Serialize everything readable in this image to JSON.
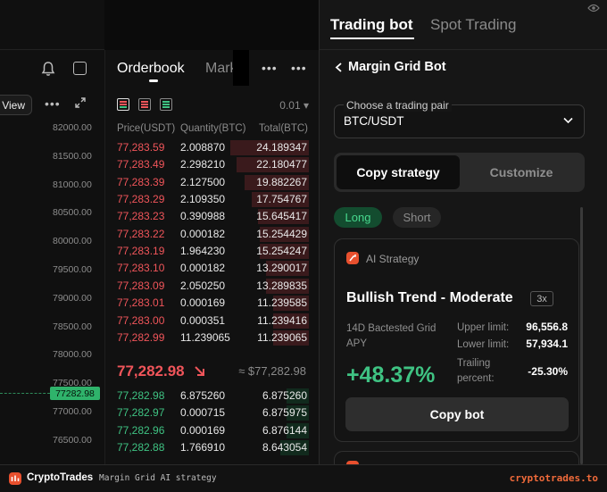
{
  "chart": {
    "view_label": "View",
    "more_icon": "more-horizontal-icon",
    "yaxis": [
      "82000.00",
      "81500.00",
      "81000.00",
      "80500.00",
      "80000.00",
      "79500.00",
      "79000.00",
      "78500.00",
      "78000.00",
      "77500.00",
      "77000.00",
      "76500.00"
    ],
    "current_price_tag": "77282.98"
  },
  "orderbook": {
    "tab_active": "Orderbook",
    "tab_other": "Mark",
    "precision": "0.01 ▾",
    "headers": {
      "price": "Price(USDT)",
      "qty": "Quantity(BTC)",
      "total": "Total(BTC)"
    },
    "asks": [
      {
        "price": "77,283.59",
        "qty": "2.008870",
        "total": "24.189347",
        "depth": 1.0
      },
      {
        "price": "77,283.49",
        "qty": "2.298210",
        "total": "22.180477",
        "depth": 0.92
      },
      {
        "price": "77,283.39",
        "qty": "2.127500",
        "total": "19.882267",
        "depth": 0.82
      },
      {
        "price": "77,283.29",
        "qty": "2.109350",
        "total": "17.754767",
        "depth": 0.73
      },
      {
        "price": "77,283.23",
        "qty": "0.390988",
        "total": "15.645417",
        "depth": 0.65
      },
      {
        "price": "77,283.22",
        "qty": "0.000182",
        "total": "15.254429",
        "depth": 0.63
      },
      {
        "price": "77,283.19",
        "qty": "1.964230",
        "total": "15.254247",
        "depth": 0.63
      },
      {
        "price": "77,283.10",
        "qty": "0.000182",
        "total": "13.290017",
        "depth": 0.55
      },
      {
        "price": "77,283.09",
        "qty": "2.050250",
        "total": "13.289835",
        "depth": 0.55
      },
      {
        "price": "77,283.01",
        "qty": "0.000169",
        "total": "11.239585",
        "depth": 0.46
      },
      {
        "price": "77,283.00",
        "qty": "0.000351",
        "total": "11.239416",
        "depth": 0.46
      },
      {
        "price": "77,282.99",
        "qty": "11.239065",
        "total": "11.239065",
        "depth": 0.46
      }
    ],
    "mid_price": "77,282.98",
    "mid_fiat": "≈ $77,282.98",
    "bids": [
      {
        "price": "77,282.98",
        "qty": "6.875260",
        "total": "6.875260",
        "depth": 0.28
      },
      {
        "price": "77,282.97",
        "qty": "0.000715",
        "total": "6.875975",
        "depth": 0.28
      },
      {
        "price": "77,282.96",
        "qty": "0.000169",
        "total": "6.876144",
        "depth": 0.28
      },
      {
        "price": "77,282.88",
        "qty": "1.766910",
        "total": "8.643054",
        "depth": 0.36
      }
    ]
  },
  "bot": {
    "tab_active": "Trading bot",
    "tab_other": "Spot Trading",
    "title": "Margin Grid Bot",
    "pair_label": "Choose a trading pair",
    "pair_value": "BTC/USDT",
    "mode_active": "Copy strategy",
    "mode_other": "Customize",
    "direction_active": "Long",
    "direction_other": "Short",
    "card": {
      "badge": "AI Strategy",
      "title": "Bullish Trend - Moderate",
      "leverage": "3x",
      "apy_label": "14D Bactested Grid APY",
      "apy_value": "+48.37%",
      "upper_label": "Upper limit:",
      "upper_value": "96,556.8",
      "lower_label": "Lower limit:",
      "lower_value": "57,934.1",
      "trail_label": "Trailing percent:",
      "trail_value": "-25.30%",
      "button": "Copy bot"
    }
  },
  "footer": {
    "brand": "CryptoTrades",
    "caption": "Margin Grid AI strategy",
    "site": "cryptotrades.to"
  },
  "colors": {
    "ask": "#f0555a",
    "bid": "#3fc383",
    "accent": "#e8502e"
  }
}
